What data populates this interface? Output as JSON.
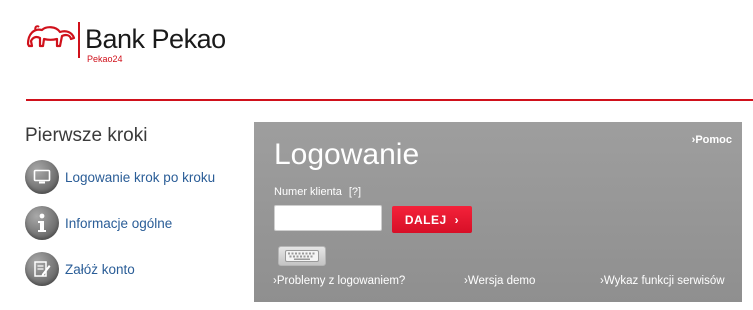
{
  "header": {
    "brand_name": "Bank Pekao",
    "brand_sub": "Pekao24",
    "accent_color": "#d0111b"
  },
  "sidebar": {
    "title": "Pierwsze kroki",
    "items": [
      {
        "label": "Logowanie krok po kroku",
        "icon": "monitor-icon"
      },
      {
        "label": "Informacje ogólne",
        "icon": "info-icon"
      },
      {
        "label": "Załóż konto",
        "icon": "edit-document-icon"
      }
    ]
  },
  "login": {
    "help_label": "Pomoc",
    "title": "Logowanie",
    "client_number_label": "Numer klienta",
    "client_number_help": "[?]",
    "client_number_value": "",
    "next_button_label": "DALEJ",
    "keyboard_icon": "keyboard-icon",
    "links": [
      "Problemy z logowaniem?",
      "Wersja demo",
      "Wykaz funkcji serwisów"
    ],
    "panel_color": "#969696",
    "button_color": "#e8142c"
  }
}
